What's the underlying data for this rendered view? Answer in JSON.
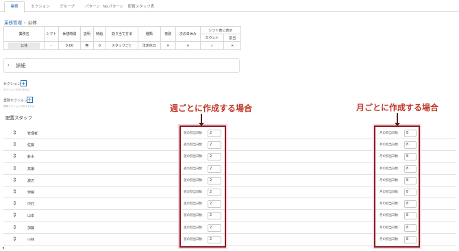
{
  "tabs": [
    "業務",
    "セクション",
    "グループ",
    "パターン",
    "NGパターン",
    "配置スタッフ表"
  ],
  "breadcrumb": {
    "parent": "業務管理",
    "separator": "›",
    "current": "公休"
  },
  "summary_table": {
    "headers": [
      "業務名",
      "シフト",
      "休憩時間",
      "説明",
      "時給",
      "割り当て方法",
      "種類",
      "夜勤",
      "次の日休み",
      "シフト表に表示"
    ],
    "sub_headers": [
      "カウント",
      "割当"
    ],
    "row": [
      "公休",
      "-",
      "0:00",
      "無",
      "0",
      "スタッフごと",
      "法定休日",
      "✕",
      "✕",
      "✓",
      "✕"
    ]
  },
  "details": {
    "label": "詳細",
    "chevron": "chevron-right-icon"
  },
  "sections": {
    "section_label": "セクション",
    "section_sub": "セクションがありません",
    "task_section_label": "業務セクション",
    "task_section_sub": "業務セクションがありません"
  },
  "staff_title": "配置スタッフ",
  "weekly_label": "週の割当日数",
  "monthly_label": "月の割当日数",
  "staff": [
    {
      "name": "管理者",
      "weekly": "2",
      "monthly": "8"
    },
    {
      "name": "佐藤",
      "weekly": "2",
      "monthly": "8"
    },
    {
      "name": "鈴木",
      "weekly": "2",
      "monthly": "8"
    },
    {
      "name": "高橋",
      "weekly": "2",
      "monthly": "8"
    },
    {
      "name": "渡辺",
      "weekly": "2",
      "monthly": "8"
    },
    {
      "name": "伊藤",
      "weekly": "2",
      "monthly": "8"
    },
    {
      "name": "中村",
      "weekly": "2",
      "monthly": "8"
    },
    {
      "name": "山本",
      "weekly": "2",
      "monthly": "8"
    },
    {
      "name": "加藤",
      "weekly": "2",
      "monthly": "8"
    },
    {
      "name": "小林",
      "weekly": "2",
      "monthly": "8"
    }
  ],
  "annotations": {
    "weekly": "週ごとに作成する場合",
    "monthly": "月ごとに作成する場合",
    "color": "#c0392b",
    "box_color": "#8b1a1a"
  }
}
